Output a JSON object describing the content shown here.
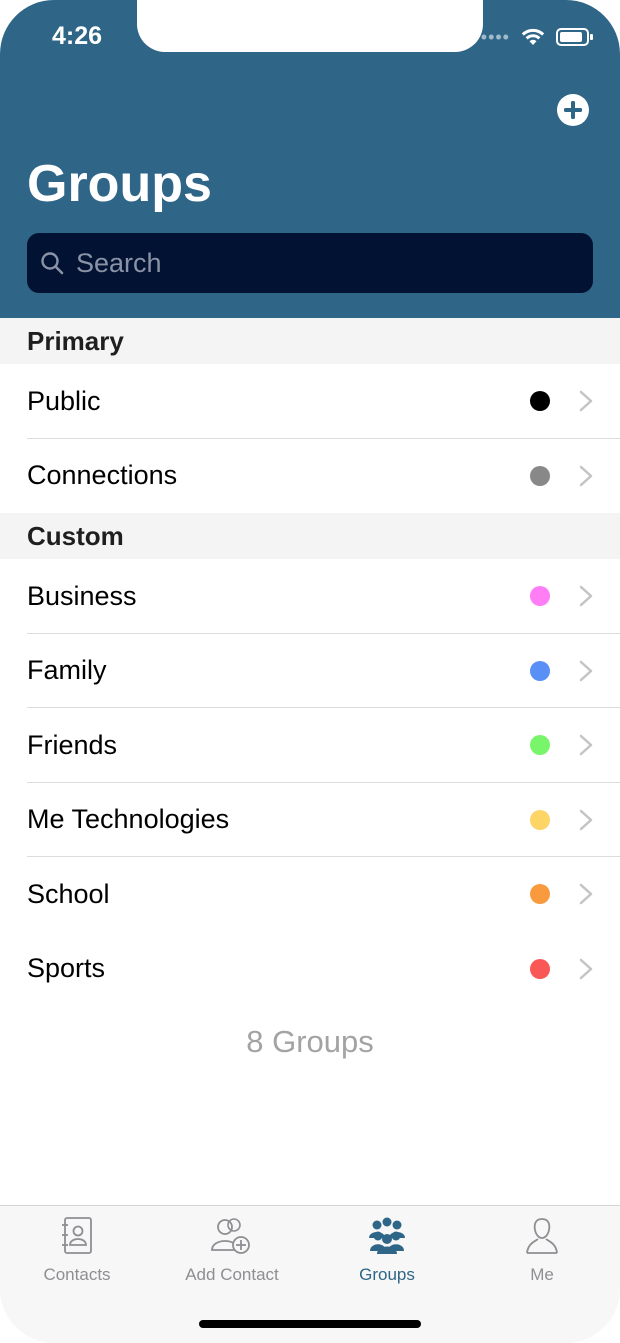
{
  "status_bar": {
    "time": "4:26"
  },
  "header": {
    "title": "Groups",
    "add_icon": "plus-circle-icon"
  },
  "search": {
    "placeholder": "Search"
  },
  "sections": [
    {
      "title": "Primary",
      "items": [
        {
          "label": "Public",
          "color": "#000000"
        },
        {
          "label": "Connections",
          "color": "#888888"
        }
      ]
    },
    {
      "title": "Custom",
      "items": [
        {
          "label": "Business",
          "color": "#ff7ef5"
        },
        {
          "label": "Family",
          "color": "#5a8ff5"
        },
        {
          "label": "Friends",
          "color": "#79f56c"
        },
        {
          "label": "Me Technologies",
          "color": "#fdd466"
        },
        {
          "label": "School",
          "color": "#f99a3e"
        },
        {
          "label": "Sports",
          "color": "#fa5757"
        }
      ]
    }
  ],
  "footer": {
    "count_text": "8 Groups"
  },
  "tab_bar": {
    "tabs": [
      {
        "label": "Contacts",
        "icon": "address-book-icon",
        "active": false
      },
      {
        "label": "Add Contact",
        "icon": "add-contact-icon",
        "active": false
      },
      {
        "label": "Groups",
        "icon": "groups-icon",
        "active": true
      },
      {
        "label": "Me",
        "icon": "person-icon",
        "active": false
      }
    ]
  },
  "colors": {
    "header_bg": "#2f6688",
    "search_bg": "#021232",
    "active_tab": "#2f6688"
  }
}
